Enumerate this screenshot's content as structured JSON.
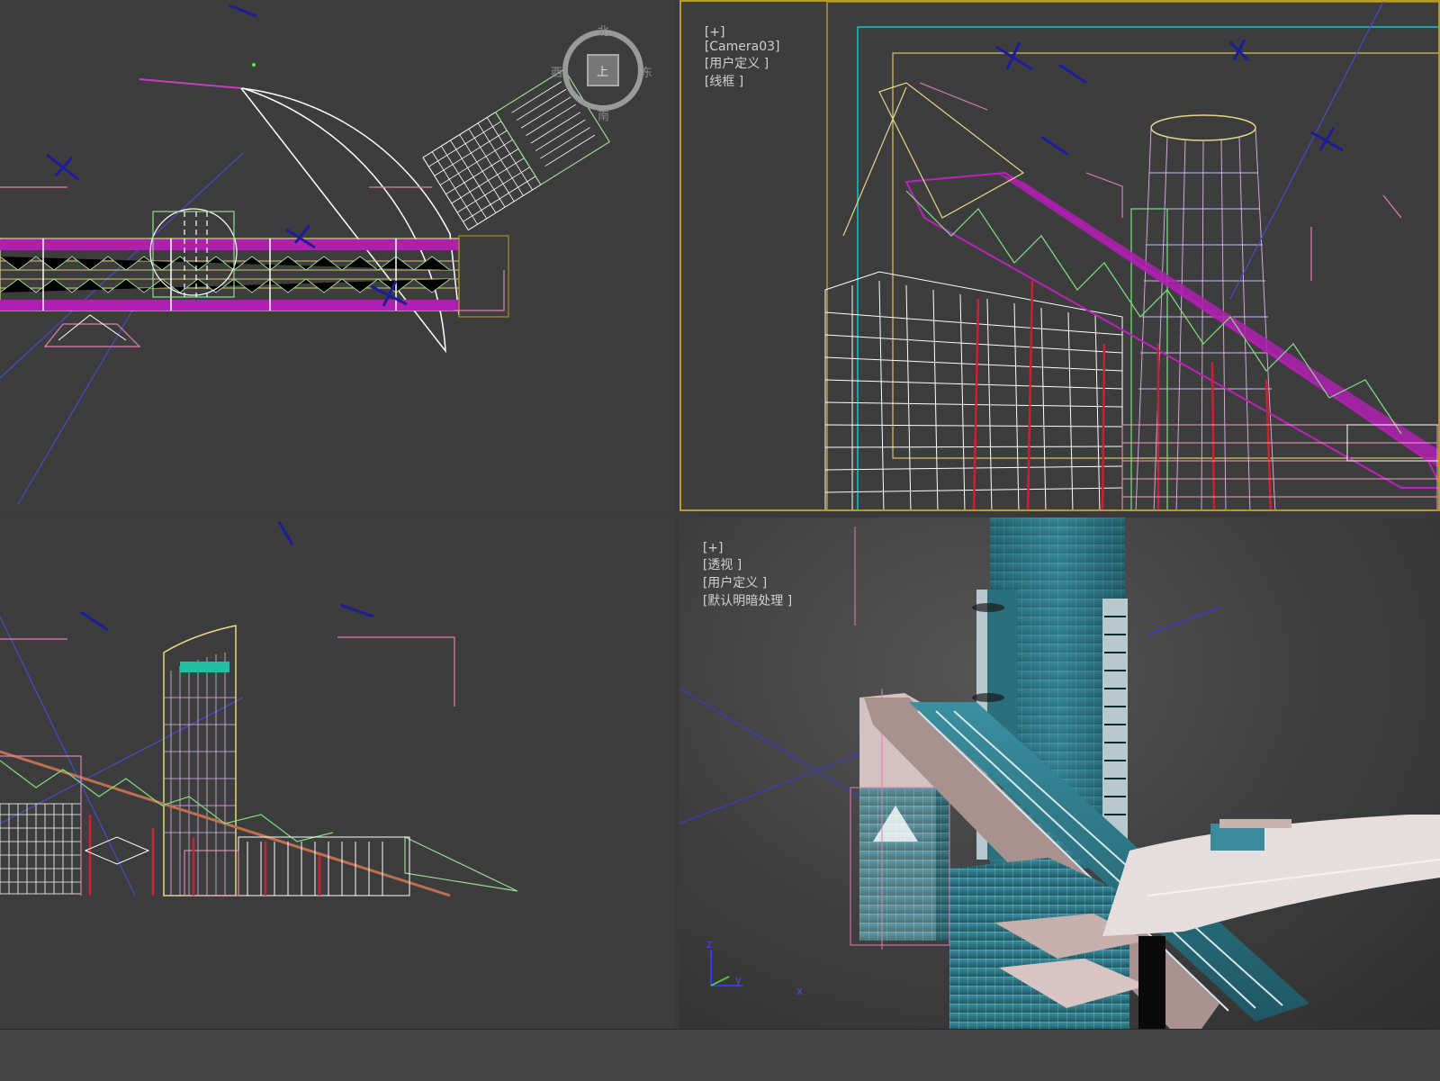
{
  "viewports": {
    "top": {
      "name": "top-viewport"
    },
    "camera": {
      "label_parts": [
        "[+]",
        "[Camera03]",
        "[用户定义 ]",
        "[线框 ]"
      ]
    },
    "front": {
      "name": "front-viewport"
    },
    "perspective": {
      "label_parts": [
        "[+]",
        "[透视 ]",
        "[用户定义 ]",
        "[默认明暗处理 ]"
      ]
    }
  },
  "viewcube": {
    "north": "北",
    "south": "南",
    "east": "东",
    "west": "西",
    "face": "上"
  },
  "axis_tripod": {
    "z": "z",
    "y": "y",
    "x": "x"
  },
  "colors": {
    "viewport_bg": "#3d3d3d",
    "active_border": "#b59a2a",
    "magenta": "#c020c0",
    "wire_white": "#ffffff",
    "wire_green": "#7ee07e",
    "wire_yellow": "#e6d78a",
    "wire_pink": "#e080b0",
    "camera_blue": "#1a1a9a",
    "glass_teal": "#2e7f8f"
  }
}
